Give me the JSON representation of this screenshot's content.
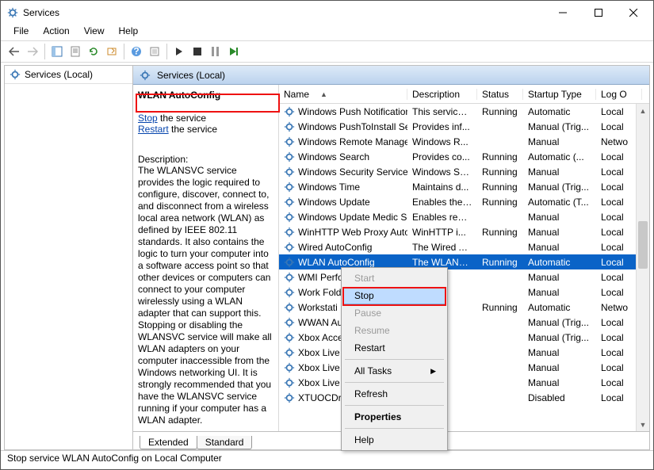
{
  "window": {
    "title": "Services"
  },
  "menu": [
    "File",
    "Action",
    "View",
    "Help"
  ],
  "tree": {
    "root": "Services (Local)"
  },
  "rightHeader": "Services (Local)",
  "detail": {
    "heading": "WLAN AutoConfig",
    "linkStop": "Stop",
    "afterStop": " the service",
    "linkRestart": "Restart",
    "afterRestart": " the service",
    "descLabel": "Description:",
    "descText": "The WLANSVC service provides the logic required to configure, discover, connect to, and disconnect from a wireless local area network (WLAN) as defined by IEEE 802.11 standards. It also contains the logic to turn your computer into a software access point so that other devices or computers can connect to your computer wirelessly using a WLAN adapter that can support this. Stopping or disabling the WLANSVC service will make all WLAN adapters on your computer inaccessible from the Windows networking UI. It is strongly recommended that you have the WLANSVC service running if your computer has a WLAN adapter."
  },
  "columns": {
    "name": "Name",
    "desc": "Description",
    "status": "Status",
    "startup": "Startup Type",
    "logon": "Log O"
  },
  "services": [
    {
      "name": "Windows Push Notification...",
      "desc": "This service ...",
      "status": "Running",
      "type": "Automatic",
      "log": "Local"
    },
    {
      "name": "Windows PushToInstall Serv...",
      "desc": "Provides inf...",
      "status": "",
      "type": "Manual (Trig...",
      "log": "Local"
    },
    {
      "name": "Windows Remote Manage...",
      "desc": "Windows R...",
      "status": "",
      "type": "Manual",
      "log": "Netwo"
    },
    {
      "name": "Windows Search",
      "desc": "Provides co...",
      "status": "Running",
      "type": "Automatic (...",
      "log": "Local"
    },
    {
      "name": "Windows Security Service",
      "desc": "Windows Se...",
      "status": "Running",
      "type": "Manual",
      "log": "Local"
    },
    {
      "name": "Windows Time",
      "desc": "Maintains d...",
      "status": "Running",
      "type": "Manual (Trig...",
      "log": "Local"
    },
    {
      "name": "Windows Update",
      "desc": "Enables the ...",
      "status": "Running",
      "type": "Automatic (T...",
      "log": "Local"
    },
    {
      "name": "Windows Update Medic Ser...",
      "desc": "Enables rem...",
      "status": "",
      "type": "Manual",
      "log": "Local"
    },
    {
      "name": "WinHTTP Web Proxy Auto-...",
      "desc": "WinHTTP i...",
      "status": "Running",
      "type": "Manual",
      "log": "Local"
    },
    {
      "name": "Wired AutoConfig",
      "desc": "The Wired A...",
      "status": "",
      "type": "Manual",
      "log": "Local"
    },
    {
      "name": "WLAN AutoConfig",
      "desc": "The WLANS...",
      "status": "Running",
      "type": "Automatic",
      "log": "Local",
      "selected": true
    },
    {
      "name": "WMI Perfo",
      "desc": "s pe...",
      "status": "",
      "type": "Manual",
      "log": "Local"
    },
    {
      "name": "Work Fold",
      "desc": "vice ...",
      "status": "",
      "type": "Manual",
      "log": "Local"
    },
    {
      "name": "Workstati",
      "desc": "nd...",
      "status": "Running",
      "type": "Automatic",
      "log": "Netwo"
    },
    {
      "name": "WWAN Au",
      "desc": "vice ...",
      "status": "",
      "type": "Manual (Trig...",
      "log": "Local"
    },
    {
      "name": "Xbox Acce",
      "desc": "vice ...",
      "status": "",
      "type": "Manual (Trig...",
      "log": "Local"
    },
    {
      "name": "Xbox Live",
      "desc": "s au...",
      "status": "",
      "type": "Manual",
      "log": "Local"
    },
    {
      "name": "Xbox Live",
      "desc": "vice ...",
      "status": "",
      "type": "Manual",
      "log": "Local"
    },
    {
      "name": "Xbox Live",
      "desc": "vice ...",
      "status": "",
      "type": "Manual",
      "log": "Local"
    },
    {
      "name": "XTUOCDriv",
      "desc": "Ov...",
      "status": "",
      "type": "Disabled",
      "log": "Local"
    }
  ],
  "context": {
    "items": [
      {
        "label": "Start",
        "disabled": true
      },
      {
        "label": "Stop",
        "hover": true
      },
      {
        "label": "Pause",
        "disabled": true
      },
      {
        "label": "Resume",
        "disabled": true
      },
      {
        "label": "Restart"
      },
      {
        "sep": true
      },
      {
        "label": "All Tasks",
        "submenu": true
      },
      {
        "sep": true
      },
      {
        "label": "Refresh"
      },
      {
        "sep": true
      },
      {
        "label": "Properties",
        "bold": true
      },
      {
        "sep": true
      },
      {
        "label": "Help"
      }
    ]
  },
  "tabs": {
    "extended": "Extended",
    "standard": "Standard"
  },
  "statusbar": "Stop service WLAN AutoConfig on Local Computer"
}
